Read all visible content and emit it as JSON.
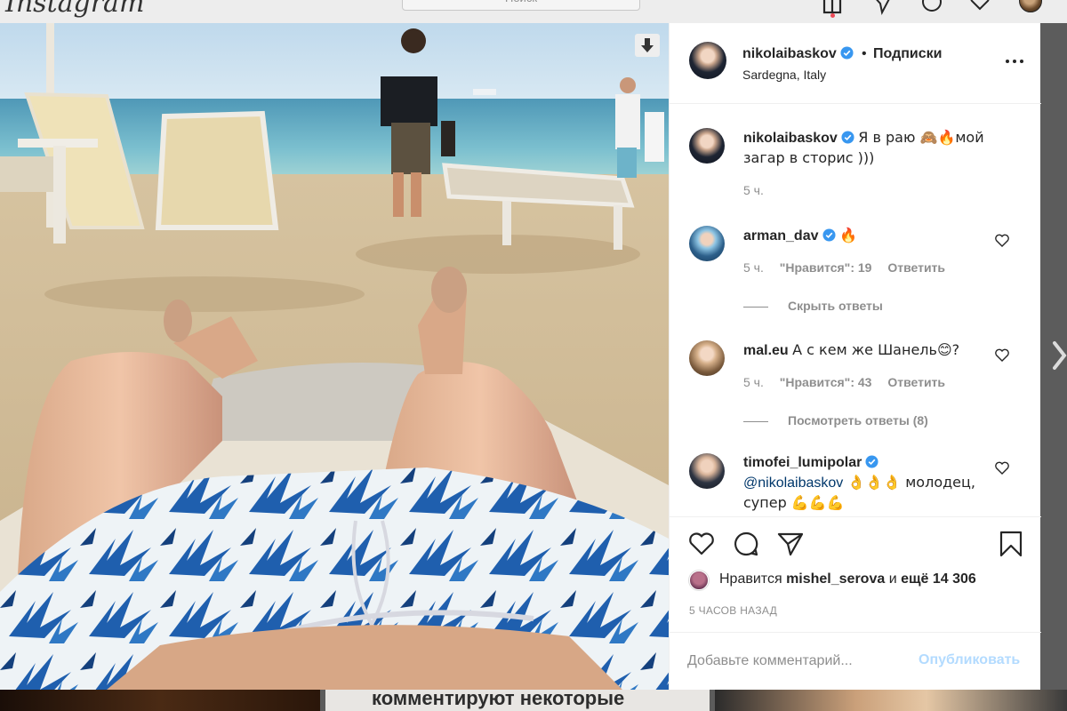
{
  "app": {
    "logo_text": "Instagram",
    "search_placeholder": "Поиск"
  },
  "nav": {
    "icons": [
      "home-icon",
      "direct-icon",
      "explore-icon",
      "activity-heart-icon",
      "profile-avatar"
    ]
  },
  "post": {
    "author": {
      "username": "nikolaibaskov",
      "verified": true,
      "follow_status": "Подписки",
      "separator": "•",
      "location": "Sardegna, Italy"
    },
    "caption": {
      "username": "nikolaibaskov",
      "text": "Я в раю 🙈🔥мой загар в сторис )))",
      "time": "5 ч."
    },
    "comments": [
      {
        "username": "arman_dav",
        "verified": true,
        "text": "🔥",
        "time": "5 ч.",
        "likes": "\"Нравится\": 19",
        "reply": "Ответить",
        "replies_label": "Скрыть ответы"
      },
      {
        "username": "mal.eu",
        "verified": false,
        "text": "А с кем же Шанель😊?",
        "time": "5 ч.",
        "likes": "\"Нравится\": 43",
        "reply": "Ответить",
        "replies_label": "Посмотреть ответы (8)"
      },
      {
        "username": "timofei_lumipolar",
        "verified": true,
        "mention": "@nikolaibaskov",
        "text": " 👌👌👌 молодец, супер 💪💪💪"
      }
    ],
    "likes": {
      "prefix": "Нравится",
      "user": "mishel_serova",
      "joiner": "и",
      "others": "ещё 14 306"
    },
    "time_ago": "5 ЧАСОВ НАЗАД",
    "add_comment": {
      "placeholder": "Добавьте комментарий...",
      "publish_label": "Опубликовать"
    }
  },
  "feed_below": {
    "headline_fragment": "комментируют некоторые"
  },
  "colors": {
    "link_blue": "#00376b",
    "publish_disabled": "#b3dbff",
    "verified_blue": "#3897f0",
    "muted_text": "#8e8e8e"
  }
}
